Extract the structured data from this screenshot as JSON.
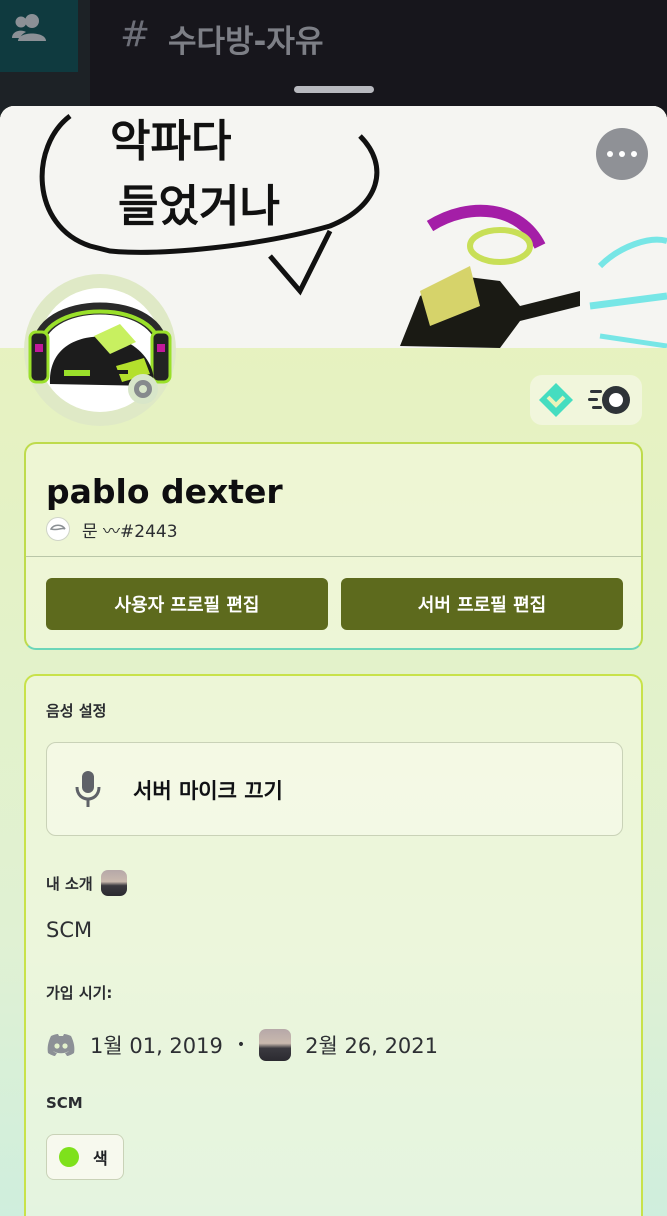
{
  "channel": {
    "hash": "#",
    "name": "수다방-자유"
  },
  "banner": {
    "text_line1": "악파다",
    "text_line2": "들었거나"
  },
  "profile": {
    "display_name": "pablo dexter",
    "tag": "문 〰#2443",
    "edit_user_profile": "사용자 프로필 편집",
    "edit_server_profile": "서버 프로필 편집"
  },
  "voice": {
    "label": "음성 설정",
    "server_mute": "서버 마이크 끄기"
  },
  "about": {
    "label": "내 소개",
    "text": "SCM"
  },
  "member_since": {
    "label": "가입 시기:",
    "discord_date": "1월 01, 2019",
    "separator": "•",
    "server_date": "2월 26, 2021"
  },
  "roles": {
    "label": "SCM",
    "items": [
      {
        "name": "색",
        "color": "#7ee11b"
      }
    ]
  },
  "colors": {
    "button": "#5d6a1d",
    "accent_border": "#c8e24a",
    "status_idle": "#868a8d"
  },
  "icons": [
    "members-icon",
    "more-icon",
    "hypesquad-balance-icon",
    "nitro-boost-icon",
    "mic-icon",
    "discord-icon"
  ]
}
